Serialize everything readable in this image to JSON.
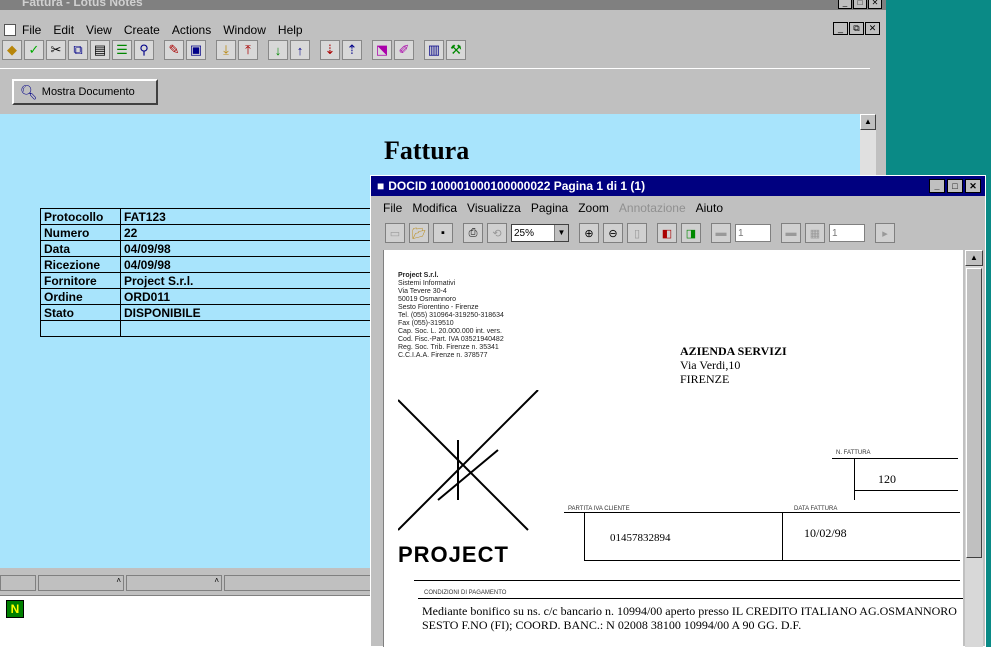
{
  "main_window": {
    "title": "Fattura - Lotus Notes",
    "menu": [
      "File",
      "Edit",
      "View",
      "Create",
      "Actions",
      "Window",
      "Help"
    ],
    "action_button_label": "Mostra Documento",
    "form_title": "Fattura",
    "fields": [
      {
        "label": "Protocollo",
        "value": "FAT123"
      },
      {
        "label": "Numero",
        "value": "22"
      },
      {
        "label": "Data",
        "value": "04/09/98"
      },
      {
        "label": "Ricezione",
        "value": "04/09/98"
      },
      {
        "label": "Fornitore",
        "value": "Project S.r.l."
      },
      {
        "label": "Ordine",
        "value": "ORD011"
      },
      {
        "label": "Stato",
        "value": "DISPONIBILE"
      },
      {
        "label": "",
        "value": ""
      }
    ]
  },
  "viewer": {
    "title": "DOCID 100001000100000022 Pagina 1  di 1 (1)",
    "menu": [
      {
        "label": "File",
        "disabled": false
      },
      {
        "label": "Modifica",
        "disabled": false
      },
      {
        "label": "Visualizza",
        "disabled": false
      },
      {
        "label": "Pagina",
        "disabled": false
      },
      {
        "label": "Zoom",
        "disabled": false
      },
      {
        "label": "Annotazione",
        "disabled": true
      },
      {
        "label": "Aiuto",
        "disabled": false
      }
    ],
    "zoom_value": "25%",
    "page_box_1": "1",
    "page_box_2": "1"
  },
  "document": {
    "sender_name": "Project S.r.l.",
    "sender_lines": [
      "Sistemi Informativi",
      "Via Tevere 30-4",
      "50019 Osmannoro",
      "Sesto Fiorentino - Firenze",
      "Tel. (055) 310964-319250-318634",
      "Fax (055)-319510",
      "Cap. Soc. L. 20.000.000 int. vers.",
      "Cod. Fisc.-Part. IVA 03521940482",
      "Reg. Soc. Trib. Firenze n. 35341",
      "C.C.I.A.A. Firenze n. 378577"
    ],
    "recipient_name": "AZIENDA SERVIZI",
    "recipient_address": "Via Verdi,10",
    "recipient_city": "FIRENZE",
    "logo_text": "PROJECT",
    "invoice_number_label": "N. FATTURA",
    "invoice_number": "120",
    "partita_iva_label": "PARTITA IVA CLIENTE",
    "partita_iva": "01457832894",
    "invoice_date_label": "DATA FATTURA",
    "invoice_date": "10/02/98",
    "payment_label": "CONDIZIONI DI PAGAMENTO",
    "payment_text": "Mediante bonifico su ns. c/c bancario  n. 10994/00 aperto presso IL CREDITO ITALIANO AG.OSMANNORO  SESTO F.NO (FI); COORD. BANC.: N 02008 38100 10994/00 A 90 GG. D.F."
  }
}
